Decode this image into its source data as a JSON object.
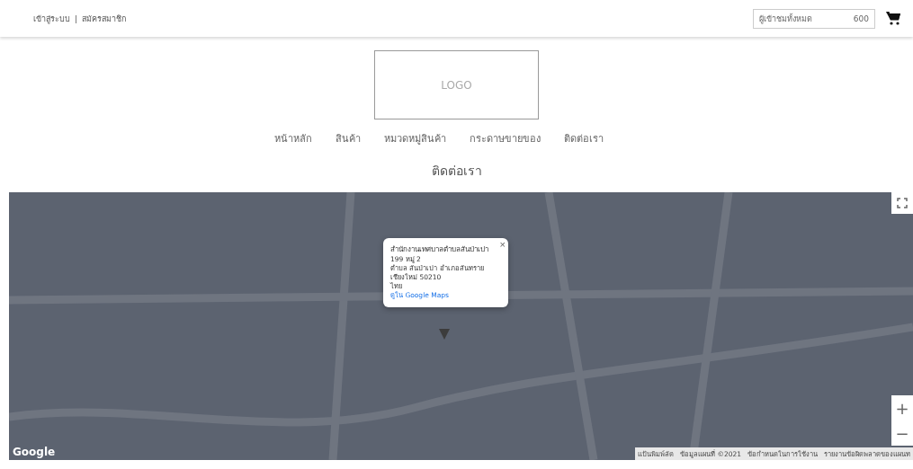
{
  "header": {
    "auth_links": [
      {
        "label": "เข้าสู่ระบบ"
      },
      {
        "label": "สมัครสมาชิก"
      }
    ],
    "separator": "|",
    "visitors": {
      "label": "ผู้เข้าชมทั้งหมด",
      "value": "600"
    }
  },
  "logo": {
    "label": "LOGO"
  },
  "nav": [
    {
      "label": "หน้าหลัก"
    },
    {
      "label": "สินค้า"
    },
    {
      "label": "หมวดหมู่สินค้า"
    },
    {
      "label": "กระดาษขายของ"
    },
    {
      "label": "ติดต่อเรา"
    }
  ],
  "page_title": "ติดต่อเรา",
  "map": {
    "info_window": {
      "title": "สำนักงานเทศบาลตำบลสันป่าเปา",
      "lines": [
        "199 หมู่ 2",
        "ตำบล สันป่าเปา อำเภอสันทราย",
        "เชียงใหม่ 50210",
        "ไทย"
      ],
      "link": "ดูใน Google Maps",
      "close": "×"
    },
    "zoom_in": "+",
    "zoom_out": "−",
    "brand": "Google",
    "attribution": [
      "แป้นพิมพ์ลัด",
      "ข้อมูลแผนที่ ©2021",
      "ข้อกำหนดในการใช้งาน",
      "รายงานข้อผิดพลาดของแผนท"
    ]
  }
}
